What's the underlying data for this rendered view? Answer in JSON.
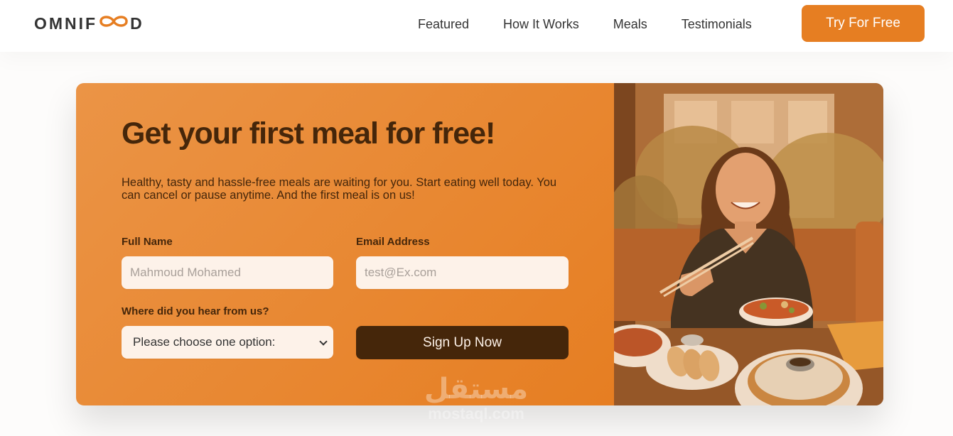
{
  "header": {
    "logo_left": "OMNIF",
    "logo_right": "D",
    "nav": [
      "Featured",
      "How It Works",
      "Meals",
      "Testimonials"
    ],
    "cta_label": "Try For Free"
  },
  "cta_section": {
    "headline": "Get your first meal for free!",
    "subtext": "Healthy, tasty and hassle-free meals are waiting for you. Start eating well today. You can cancel or pause anytime. And the first meal is on us!",
    "form": {
      "full_name_label": "Full Name",
      "full_name_placeholder": "Mahmoud Mohamed",
      "email_label": "Email Address",
      "email_placeholder": "test@Ex.com",
      "source_label": "Where did you hear from us?",
      "source_selected": "Please choose one option:",
      "submit_label": "Sign Up Now"
    }
  },
  "watermark": {
    "arabic": "مستقل",
    "latin": "mostaql.com"
  },
  "colors": {
    "accent": "#e67e22",
    "dark_brown": "#45260a",
    "input_bg": "#fdf2e9"
  },
  "icons": [
    "infinity-logo-icon",
    "chevron-down-icon"
  ]
}
